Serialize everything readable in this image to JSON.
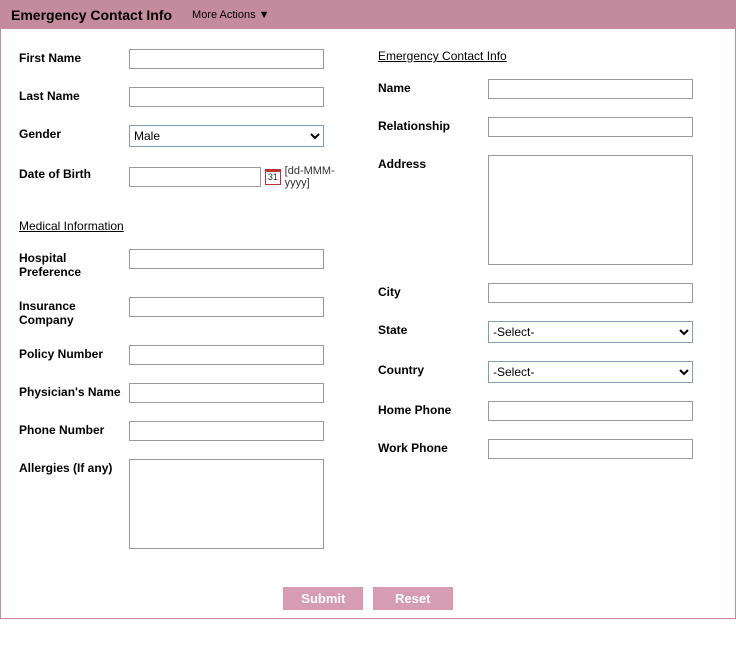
{
  "header": {
    "title": "Emergency Contact Info",
    "moreActions": "More Actions ▼"
  },
  "left": {
    "firstName": {
      "label": "First Name",
      "value": ""
    },
    "lastName": {
      "label": "Last Name",
      "value": ""
    },
    "gender": {
      "label": "Gender",
      "selected": "Male"
    },
    "dob": {
      "label": "Date of Birth",
      "value": "",
      "hint": "[dd-MMM-yyyy]",
      "calIcon": "31"
    },
    "medicalHeading": "Medical Information",
    "hospitalPref": {
      "label": "Hospital Preference",
      "value": ""
    },
    "insuranceCo": {
      "label": "Insurance Company",
      "value": ""
    },
    "policyNumber": {
      "label": "Policy Number",
      "value": ""
    },
    "physicianName": {
      "label": "Physician's Name",
      "value": ""
    },
    "phoneNumber": {
      "label": "Phone Number",
      "value": ""
    },
    "allergies": {
      "label": "Allergies (If any)",
      "value": ""
    }
  },
  "right": {
    "heading": "Emergency Contact Info",
    "name": {
      "label": "Name",
      "value": ""
    },
    "relationship": {
      "label": "Relationship",
      "value": ""
    },
    "address": {
      "label": "Address",
      "value": ""
    },
    "city": {
      "label": "City",
      "value": ""
    },
    "state": {
      "label": "State",
      "selected": "-Select-"
    },
    "country": {
      "label": "Country",
      "selected": "-Select-"
    },
    "homePhone": {
      "label": "Home Phone",
      "value": ""
    },
    "workPhone": {
      "label": "Work Phone",
      "value": ""
    }
  },
  "footer": {
    "submit": "Submit",
    "reset": "Reset"
  }
}
